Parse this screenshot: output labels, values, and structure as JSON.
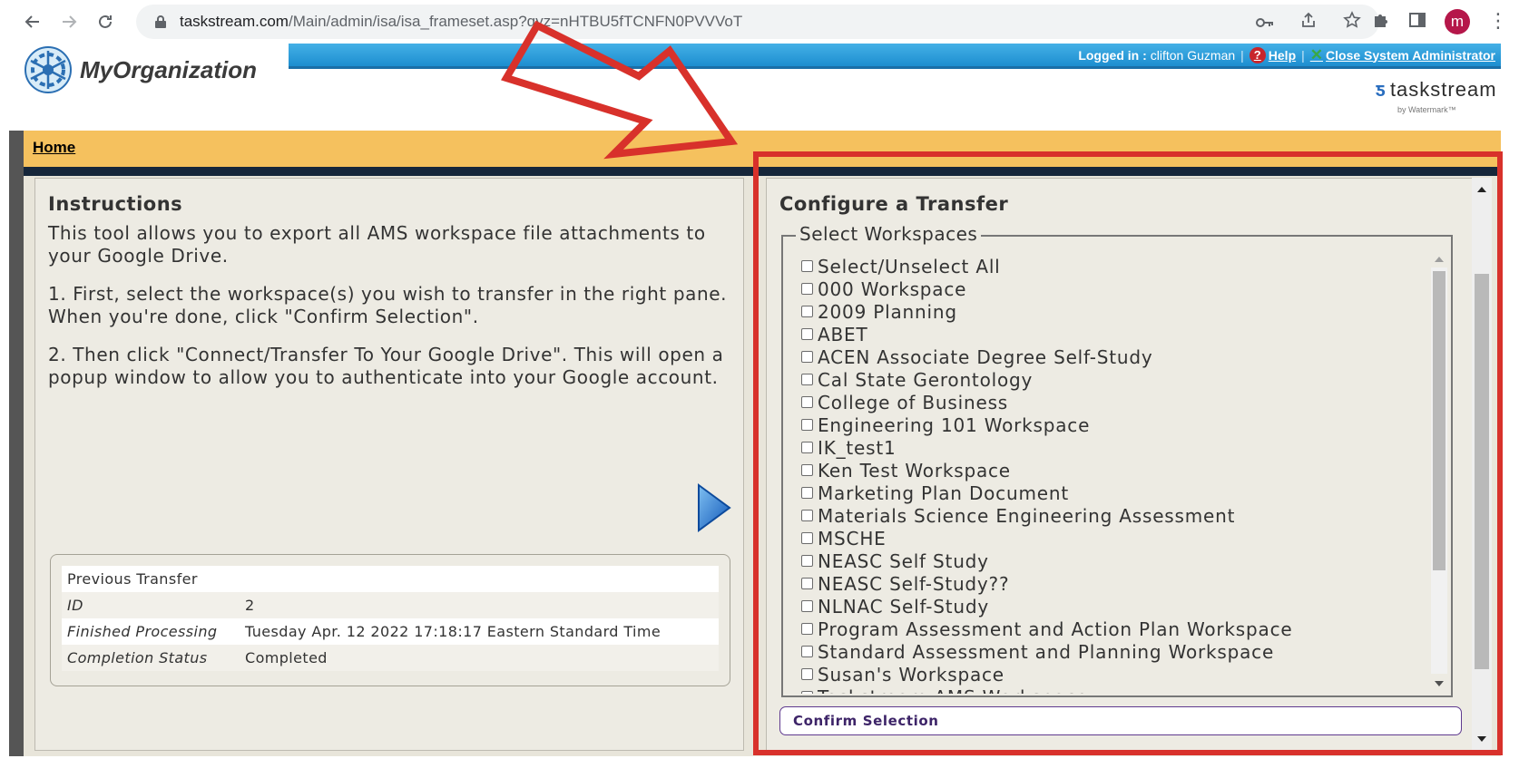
{
  "browser": {
    "url_host": "taskstream.com",
    "url_path": "/Main/admin/isa/isa_frameset.asp?qyz=nHTBU5fTCNFN0PVVVoT",
    "profile_initial": "m"
  },
  "header": {
    "org_name": "MyOrganization",
    "logged_in_label": "Logged in :",
    "logged_in_user": "clifton Guzman",
    "help_label": "Help",
    "close_admin_label": "Close System Administrator",
    "brand": "taskstream",
    "brand_sub": "by Watermark™"
  },
  "nav": {
    "home_label": "Home"
  },
  "instructions": {
    "title": "Instructions",
    "paragraphs": [
      "This tool allows you to export all AMS workspace file attachments to your Google Drive.",
      "1. First, select the workspace(s) you wish to transfer in the right pane. When you're done, click \"Confirm Selection\".",
      "2. Then click \"Connect/Transfer To Your Google Drive\". This will open a popup window to allow you to authenticate into your Google account."
    ],
    "previous_transfer": {
      "heading": "Previous Transfer",
      "rows": [
        {
          "key": "ID",
          "value": "2"
        },
        {
          "key": "Finished Processing",
          "value": "Tuesday Apr. 12 2022 17:18:17 Eastern Standard Time"
        },
        {
          "key": "Completion Status",
          "value": "Completed"
        }
      ]
    }
  },
  "configure": {
    "title": "Configure a Transfer",
    "fieldset_legend": "Select Workspaces",
    "workspaces": [
      "Select/Unselect All",
      "000 Workspace",
      "2009 Planning",
      "ABET",
      "ACEN Associate Degree Self-Study",
      "Cal State Gerontology",
      "College of Business",
      "Engineering 101 Workspace",
      "IK_test1",
      "Ken Test Workspace",
      "Marketing Plan Document",
      "Materials Science Engineering Assessment",
      "MSCHE",
      "NEASC Self Study",
      "NEASC Self-Study??",
      "NLNAC Self-Study",
      "Program Assessment and Action Plan Workspace",
      "Standard Assessment and Planning Workspace",
      "Susan's Workspace",
      "Taskstream AMS Workspace"
    ],
    "confirm_label": "Confirm Selection"
  },
  "colors": {
    "annotation": "#d8312b",
    "nav_bar": "#f5c15e",
    "header_bar": "#2a9ad8",
    "button_text": "#3d2468"
  }
}
